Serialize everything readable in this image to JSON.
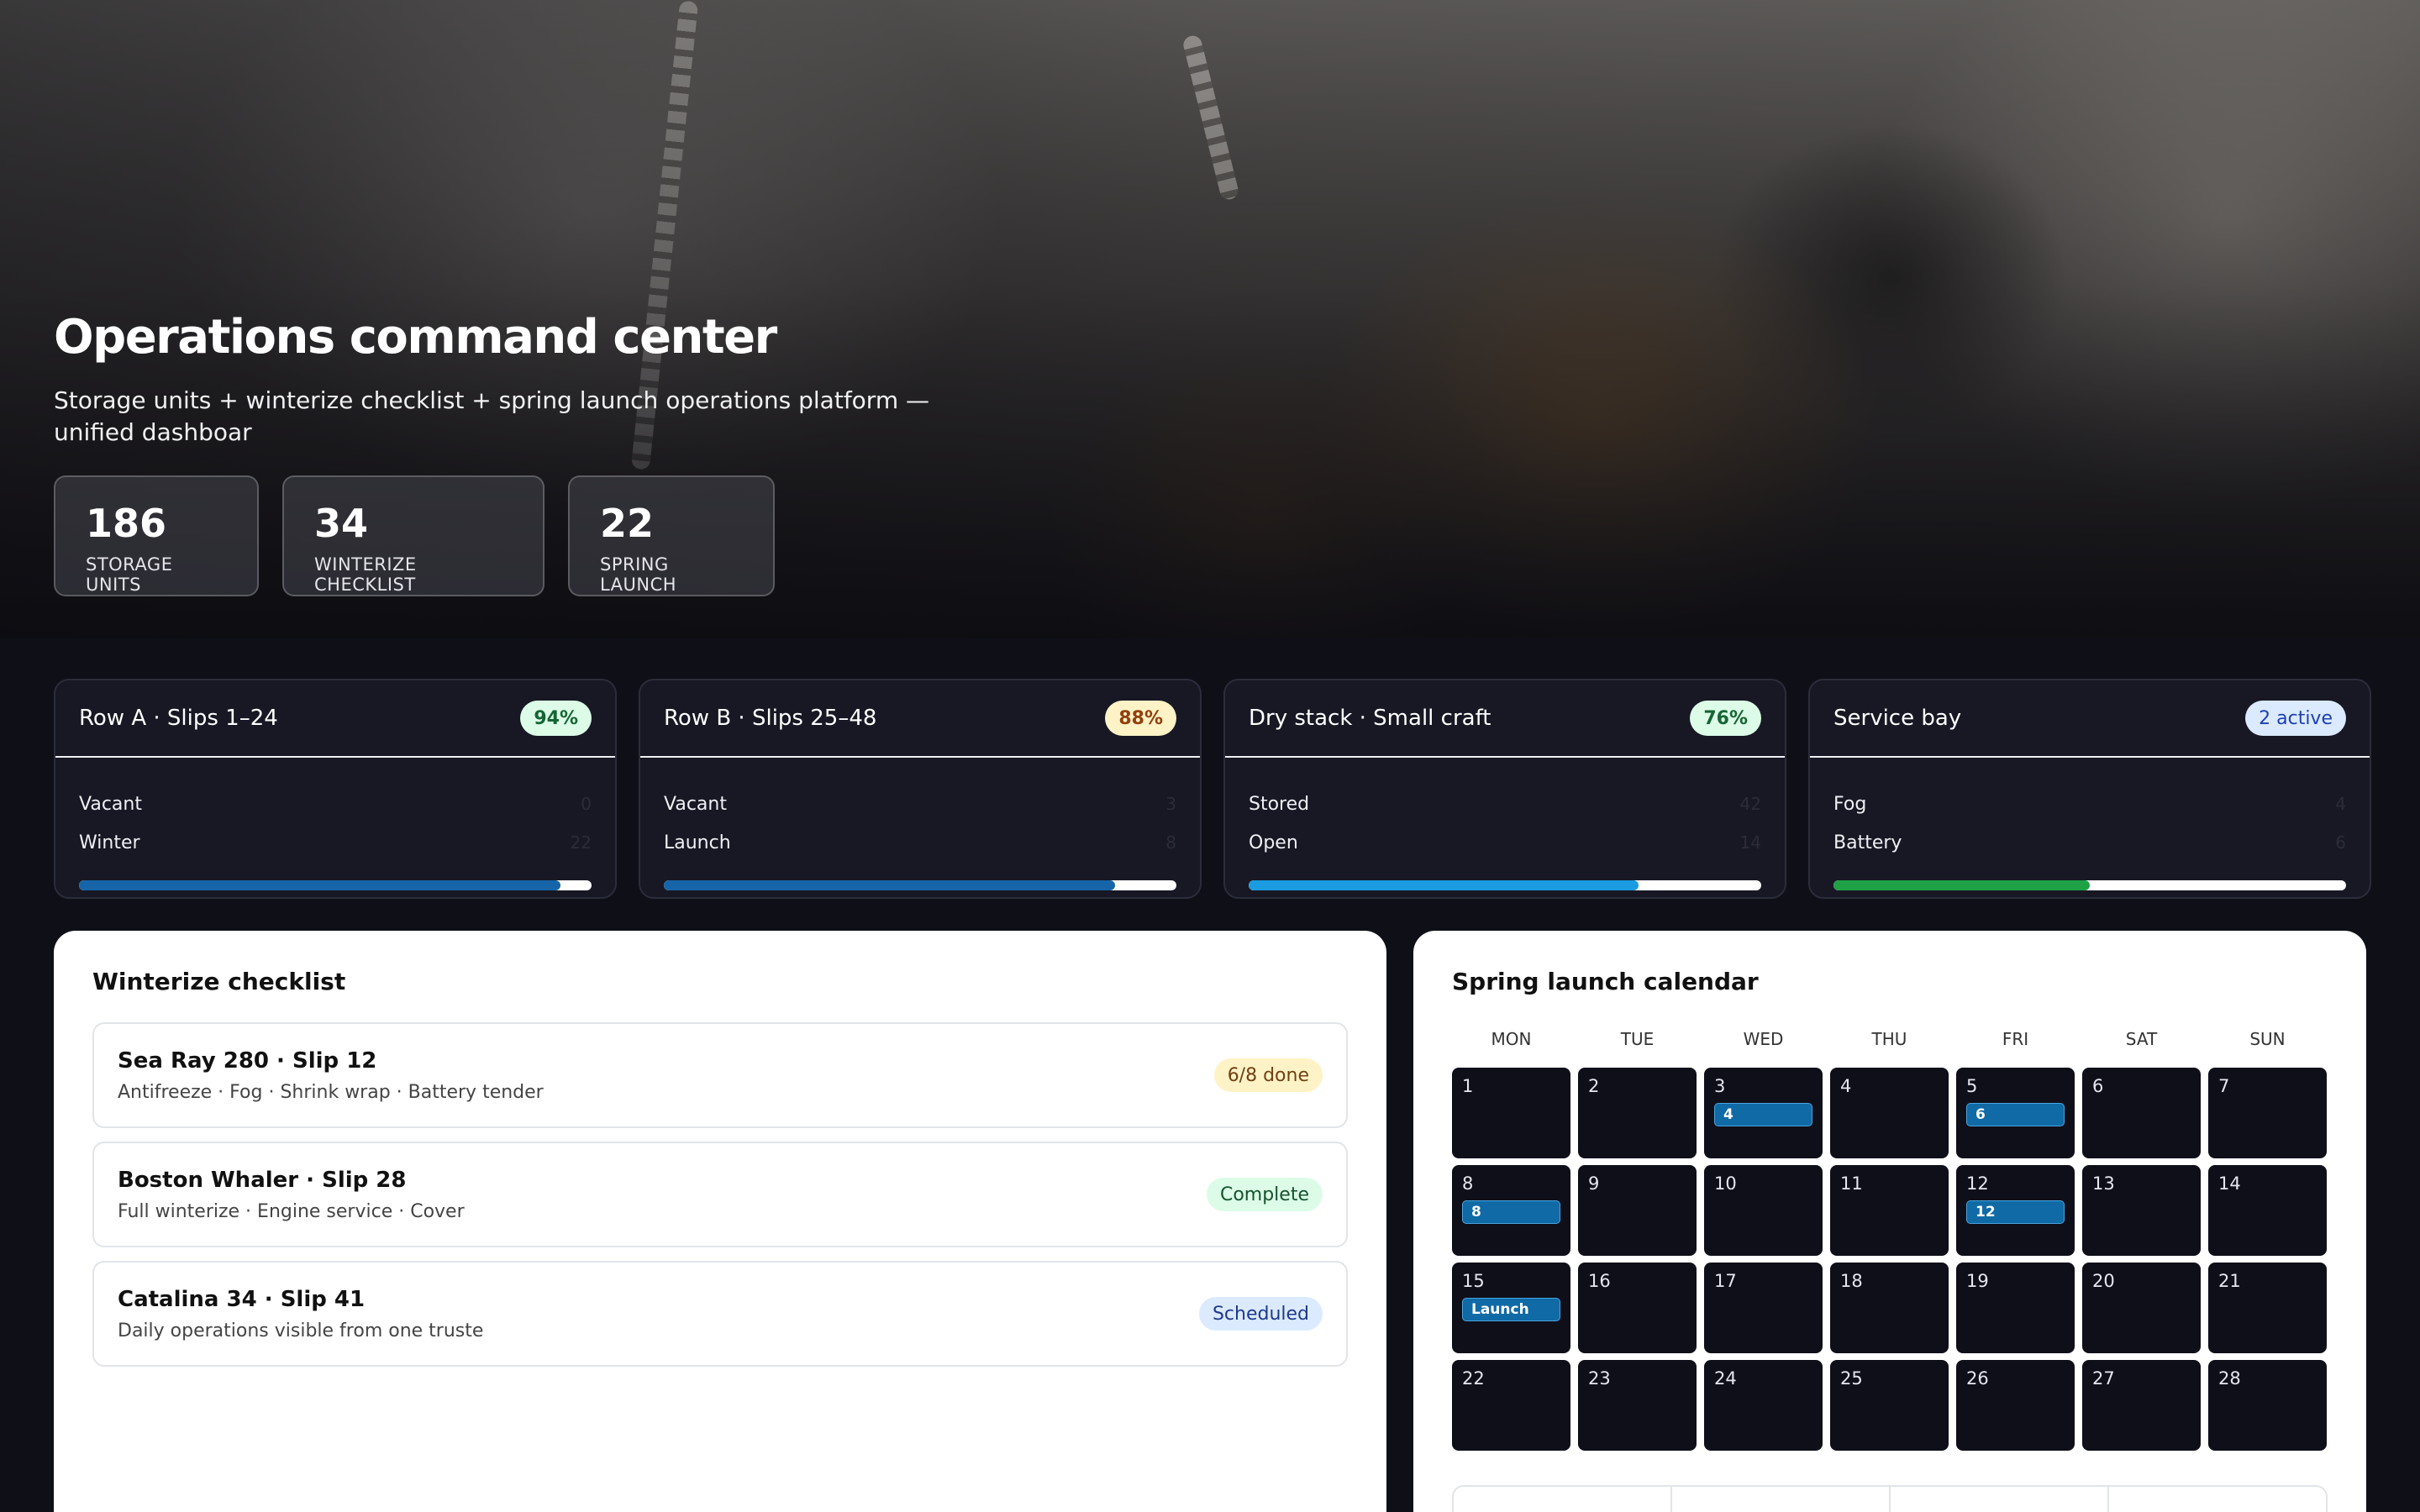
{
  "hero": {
    "title": "Operations command center",
    "subtitle": "Storage units + winterize checklist + spring launch operations platform — unified dashboar",
    "stats": [
      {
        "value": "186",
        "label": "STORAGE UNITS"
      },
      {
        "value": "34",
        "label": "WINTERIZE CHECKLIST"
      },
      {
        "value": "22",
        "label": "SPRING LAUNCH"
      }
    ]
  },
  "zones": [
    {
      "title": "Row A · Slips 1–24",
      "badge": "94%",
      "rows": [
        {
          "label": "Vacant",
          "value": "0"
        },
        {
          "label": "Winter",
          "value": "22"
        }
      ],
      "fill_percent": 94
    },
    {
      "title": "Row B · Slips 25–48",
      "badge": "88%",
      "rows": [
        {
          "label": "Vacant",
          "value": "3"
        },
        {
          "label": "Launch",
          "value": "8"
        }
      ],
      "fill_percent": 88
    },
    {
      "title": "Dry stack · Small craft",
      "badge": "76%",
      "rows": [
        {
          "label": "Stored",
          "value": "42"
        },
        {
          "label": "Open",
          "value": "14"
        }
      ],
      "fill_percent": 76
    },
    {
      "title": "Service bay",
      "badge": "2 active",
      "rows": [
        {
          "label": "Fog",
          "value": "4"
        },
        {
          "label": "Battery",
          "value": "6"
        }
      ],
      "fill_percent": 50
    }
  ],
  "colors": {
    "bar_row_a": "#1565a8",
    "bar_row_b": "#1565a8",
    "bar_dry_stack": "#1b9be0",
    "bar_service": "#1fa246"
  },
  "checklist": {
    "title": "Winterize checklist",
    "items": [
      {
        "name": "Sea Ray 280 · Slip 12",
        "desc": "Antifreeze · Fog · Shrink wrap · Battery tender",
        "status": "6/8 done"
      },
      {
        "name": "Boston Whaler · Slip 28",
        "desc": "Full winterize · Engine service · Cover",
        "status": "Complete"
      },
      {
        "name": "Catalina 34 · Slip 41",
        "desc": "Daily operations visible from one truste",
        "status": "Scheduled"
      }
    ]
  },
  "calendar": {
    "title": "Spring launch calendar",
    "weekdays": [
      "MON",
      "TUE",
      "WED",
      "THU",
      "FRI",
      "SAT",
      "SUN"
    ],
    "days": [
      {
        "n": "1"
      },
      {
        "n": "2"
      },
      {
        "n": "3",
        "event": "4"
      },
      {
        "n": "4"
      },
      {
        "n": "5",
        "event": "6"
      },
      {
        "n": "6"
      },
      {
        "n": "7"
      },
      {
        "n": "8",
        "event": "8"
      },
      {
        "n": "9"
      },
      {
        "n": "10"
      },
      {
        "n": "11"
      },
      {
        "n": "12",
        "event": "12"
      },
      {
        "n": "13"
      },
      {
        "n": "14"
      },
      {
        "n": "15",
        "event": "Launch"
      },
      {
        "n": "16"
      },
      {
        "n": "17"
      },
      {
        "n": "18"
      },
      {
        "n": "19"
      },
      {
        "n": "20"
      },
      {
        "n": "21"
      },
      {
        "n": "22"
      },
      {
        "n": "23"
      },
      {
        "n": "24"
      },
      {
        "n": "25"
      },
      {
        "n": "26"
      },
      {
        "n": "27"
      },
      {
        "n": "28"
      }
    ]
  }
}
